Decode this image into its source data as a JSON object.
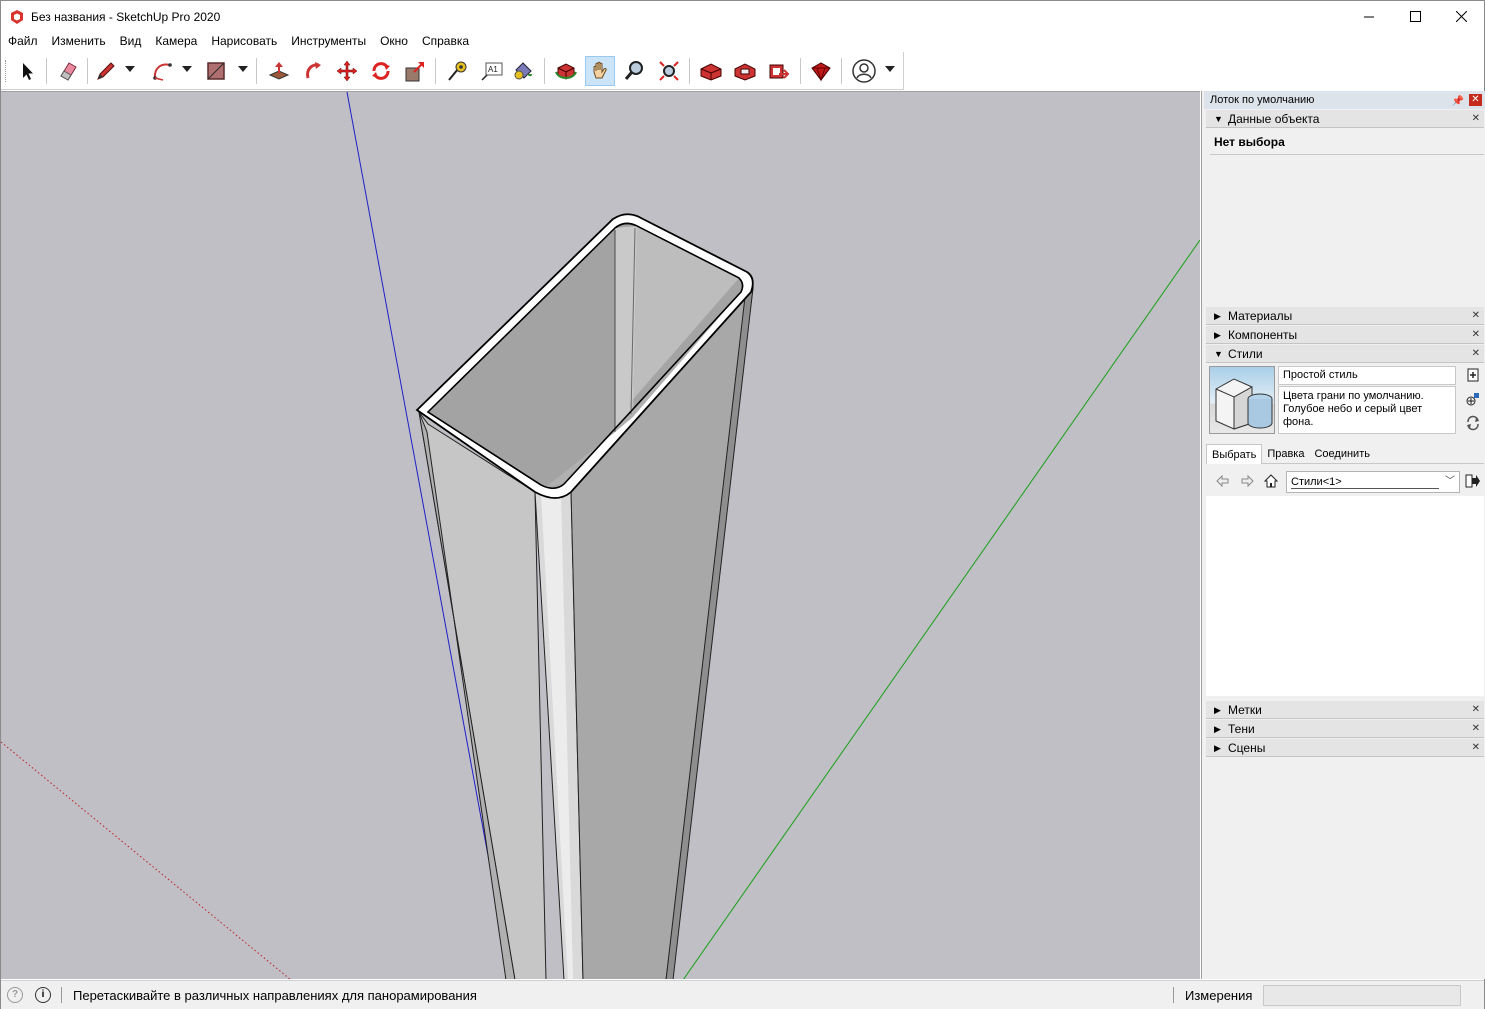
{
  "window": {
    "title": "Без названия - SketchUp Pro 2020",
    "controls": [
      "minimize-icon",
      "maximize-icon",
      "close-icon"
    ]
  },
  "menu": {
    "items": [
      "Файл",
      "Изменить",
      "Вид",
      "Камера",
      "Нарисовать",
      "Инструменты",
      "Окно",
      "Справка"
    ]
  },
  "toolbar": {
    "tools": [
      "select-icon",
      "eraser-icon",
      "pencil-icon",
      "arc-icon",
      "rectangle-icon",
      "push-pull-icon",
      "offset-icon",
      "move-icon",
      "rotate-icon",
      "scale-icon",
      "tape-measure-icon",
      "text-icon",
      "paint-bucket-icon",
      "orbit-icon",
      "pan-icon",
      "zoom-icon",
      "zoom-extents-icon",
      "3d-warehouse-icon",
      "extension-warehouse-icon",
      "layout-icon",
      "extension-manager-icon",
      "account-icon"
    ],
    "active_tool": "pan-icon"
  },
  "tray": {
    "title": "Лоток по умолчанию",
    "entity_info": {
      "header": "Данные объекта",
      "selection": "Нет выбора"
    },
    "panels_collapsed": [
      "Материалы",
      "Компоненты"
    ],
    "styles": {
      "header": "Стили",
      "style_name": "Простой стиль",
      "style_description": "Цвета грани по умолчанию. Голубое небо и серый цвет фона.",
      "tabs": [
        "Выбрать",
        "Правка",
        "Соединить"
      ],
      "active_tab": "Выбрать",
      "collection": "Стили<1>"
    },
    "panels_bottom": [
      "Метки",
      "Тени",
      "Сцены"
    ]
  },
  "status": {
    "hint": "Перетаскивайте в различных направлениях для панорамирования",
    "measure_label": "Измерения",
    "measure_value": ""
  },
  "colors": {
    "viewport_bg": "#bfbfc5",
    "axis_blue": "#2020c8",
    "axis_green": "#18a018",
    "axis_red": "#c02020",
    "active_tool_bg": "#cce4f7"
  }
}
